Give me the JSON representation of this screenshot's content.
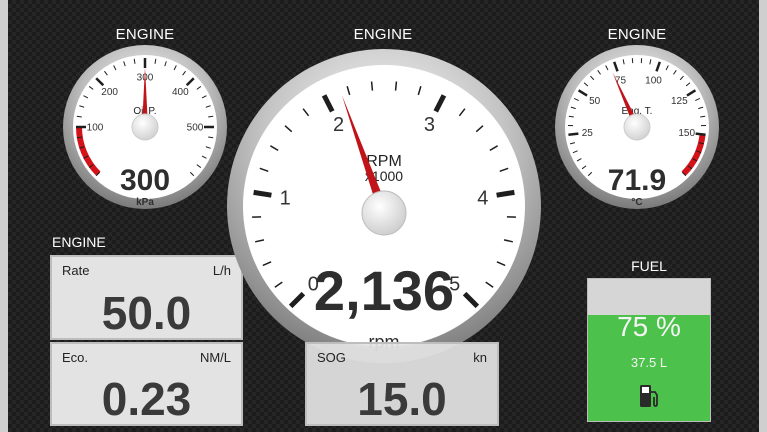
{
  "gauges": {
    "oil_pressure": {
      "title": "ENGINE",
      "label": "Oil P.",
      "value_text": "300",
      "unit": "kPa",
      "value": 300,
      "min": 0,
      "max": 600,
      "ticks": [
        100,
        200,
        300,
        400,
        500
      ],
      "tick_labels": [
        "100",
        "200",
        "300",
        "400",
        "500"
      ],
      "red_zone": [
        0,
        100
      ]
    },
    "rpm": {
      "title": "ENGINE",
      "label_line1": "RPM",
      "label_line2": "x1000",
      "value_text": "2,136",
      "unit": "rpm",
      "value": 2.136,
      "min": 0,
      "max": 5,
      "ticks": [
        0,
        1,
        2,
        3,
        4,
        5
      ],
      "tick_labels": [
        "0",
        "1",
        "2",
        "3",
        "4",
        "5"
      ]
    },
    "eng_temp": {
      "title": "ENGINE",
      "label": "Eng. T.",
      "value_text": "71.9",
      "unit": "°C",
      "value": 71.9,
      "min": 0,
      "max": 175,
      "ticks": [
        25,
        50,
        75,
        100,
        125,
        150
      ],
      "tick_labels": [
        "25",
        "50",
        "75",
        "100",
        "125",
        "150"
      ],
      "red_zone": [
        150,
        175
      ]
    }
  },
  "engine_panel_label": "ENGINE",
  "panels": {
    "rate": {
      "label": "Rate",
      "unit": "L/h",
      "value": "50.0"
    },
    "eco": {
      "label": "Eco.",
      "unit": "NM/L",
      "value": "0.23"
    },
    "sog": {
      "label": "SOG",
      "unit": "kn",
      "value": "15.0"
    }
  },
  "fuel": {
    "title": "FUEL",
    "percent_text": "75 %",
    "liters_text": "37.5 L",
    "level": 0.75,
    "fill_color": "#4cc24d",
    "icon": "fuel-pump-icon"
  },
  "colors": {
    "needle": "#c0141a",
    "red_zone": "#d4121a"
  }
}
